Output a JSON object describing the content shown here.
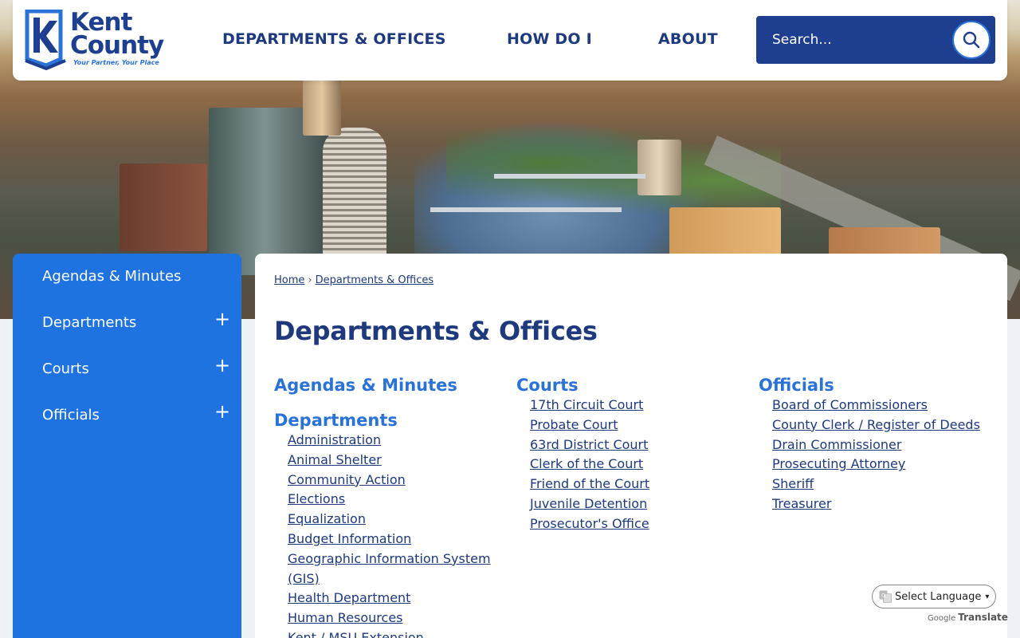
{
  "brand": {
    "name_line1": "Kent",
    "name_line2": "County",
    "tagline": "Your Partner, Your Place",
    "colors": {
      "navy": "#1e3a7d",
      "blue": "#1e73e0",
      "link_blue": "#2b72d6"
    }
  },
  "nav": {
    "items": [
      "DEPARTMENTS & OFFICES",
      "HOW DO I",
      "ABOUT"
    ]
  },
  "search": {
    "placeholder": "Search...",
    "icon": "search-icon"
  },
  "sidebar": {
    "items": [
      {
        "label": "Agendas & Minutes",
        "expandable": false
      },
      {
        "label": "Departments",
        "expandable": true
      },
      {
        "label": "Courts",
        "expandable": true
      },
      {
        "label": "Officials",
        "expandable": true
      }
    ]
  },
  "breadcrumb": {
    "home": "Home",
    "separator": "›",
    "current": "Departments & Offices"
  },
  "page_title": "Departments & Offices",
  "columns": {
    "col1": {
      "heading_a": "Agendas & Minutes",
      "heading_b": "Departments",
      "links": [
        "Administration",
        "Animal Shelter",
        "Community Action",
        "Elections",
        "Equalization",
        "Budget Information",
        "Geographic Information System (GIS)",
        "Health Department",
        "Human Resources",
        "Kent / MSU Extension"
      ]
    },
    "col2": {
      "heading": "Courts",
      "links": [
        "17th Circuit Court",
        "Probate Court",
        "63rd District Court",
        "Clerk of the Court",
        "Friend of the Court",
        "Juvenile Detention",
        "Prosecutor's Office"
      ]
    },
    "col3": {
      "heading": "Officials",
      "links": [
        "Board of Commissioners",
        "County Clerk / Register of Deeds",
        "Drain Commissioner",
        "Prosecuting Attorney",
        "Sheriff",
        "Treasurer"
      ]
    }
  },
  "translate": {
    "select_label": "Select Language",
    "powered_by": "Google",
    "translate_label": "Translate"
  }
}
